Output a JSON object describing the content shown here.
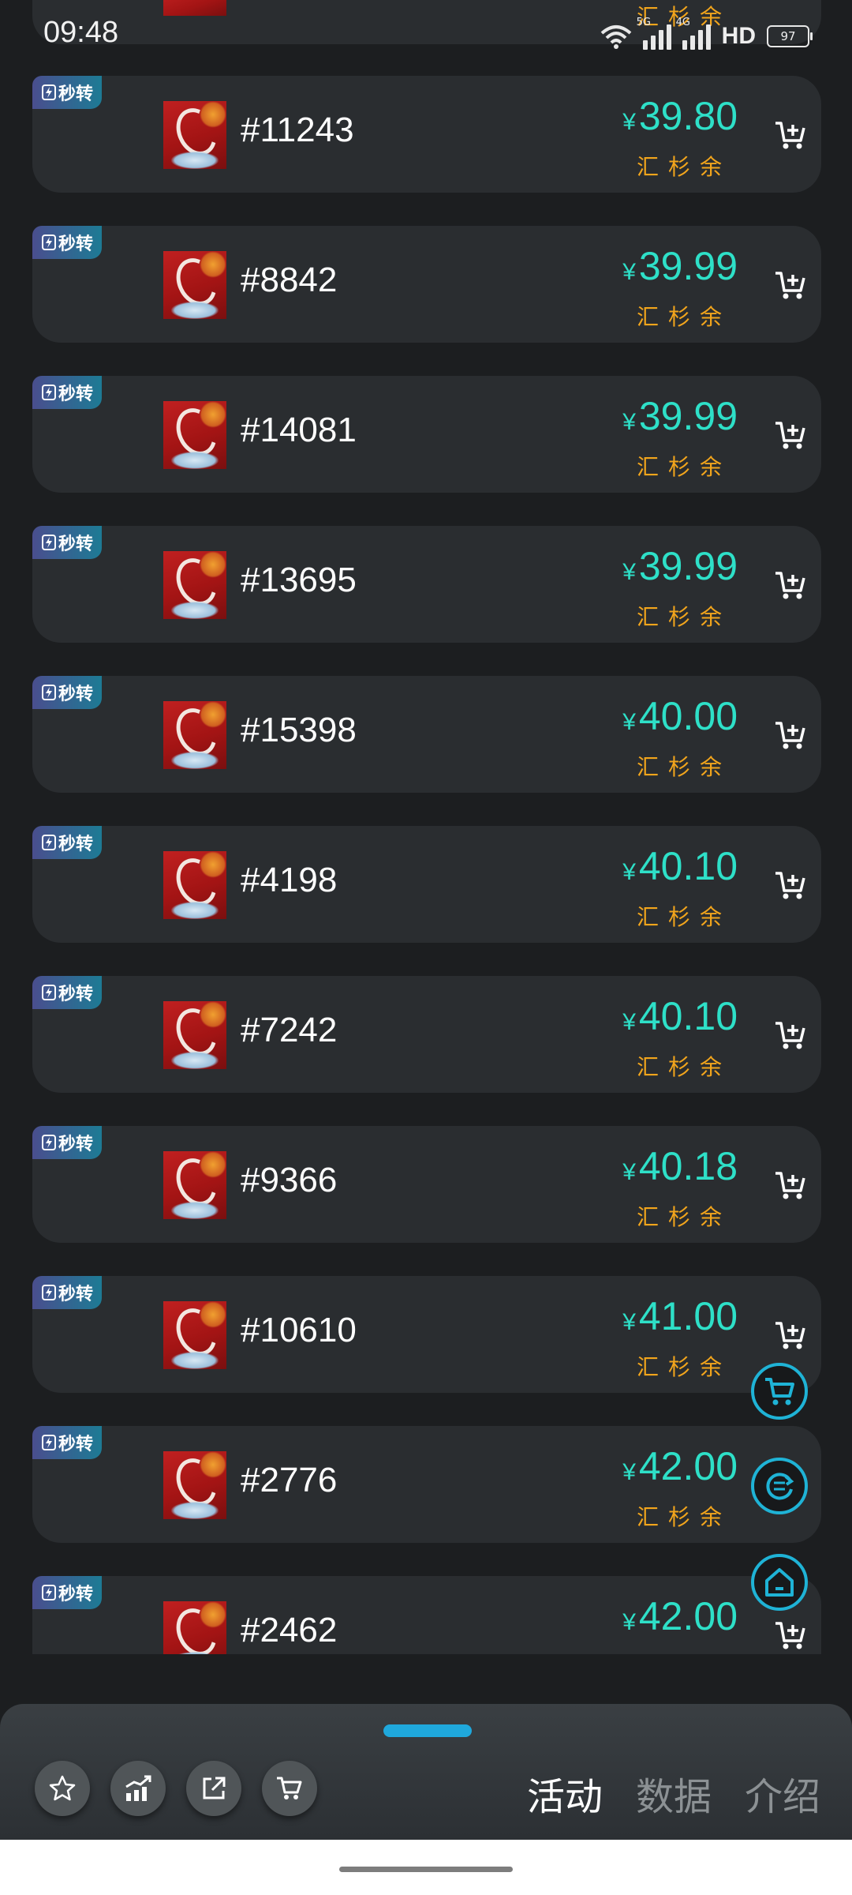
{
  "status": {
    "time": "09:48",
    "net1": "5G",
    "net2": "4G",
    "hd": "HD",
    "battery": "97"
  },
  "colors": {
    "price": "#2ee0c8",
    "tag": "#f2a51c",
    "accent": "#1fb3d6",
    "card": "#2a2d30",
    "background": "#1c1e20"
  },
  "listing": {
    "badge": "秒转",
    "currency": "¥",
    "tags": "汇杉余",
    "top_partial_tags": "汇杉余",
    "items": [
      {
        "id": "#11243",
        "price": "39.80"
      },
      {
        "id": "#8842",
        "price": "39.99"
      },
      {
        "id": "#14081",
        "price": "39.99"
      },
      {
        "id": "#13695",
        "price": "39.99"
      },
      {
        "id": "#15398",
        "price": "40.00"
      },
      {
        "id": "#4198",
        "price": "40.10"
      },
      {
        "id": "#7242",
        "price": "40.10"
      },
      {
        "id": "#9366",
        "price": "40.18"
      },
      {
        "id": "#10610",
        "price": "41.00"
      },
      {
        "id": "#2776",
        "price": "42.00"
      },
      {
        "id": "#2462",
        "price": "42.00"
      }
    ]
  },
  "floating": [
    "cart-icon",
    "refresh-icon",
    "home-icon"
  ],
  "bottom": {
    "tools": [
      "star-icon",
      "trend-chart-icon",
      "share-icon",
      "cart-icon"
    ],
    "tabs": [
      {
        "label": "活动",
        "active": true
      },
      {
        "label": "数据",
        "active": false
      },
      {
        "label": "介绍",
        "active": false
      }
    ]
  }
}
